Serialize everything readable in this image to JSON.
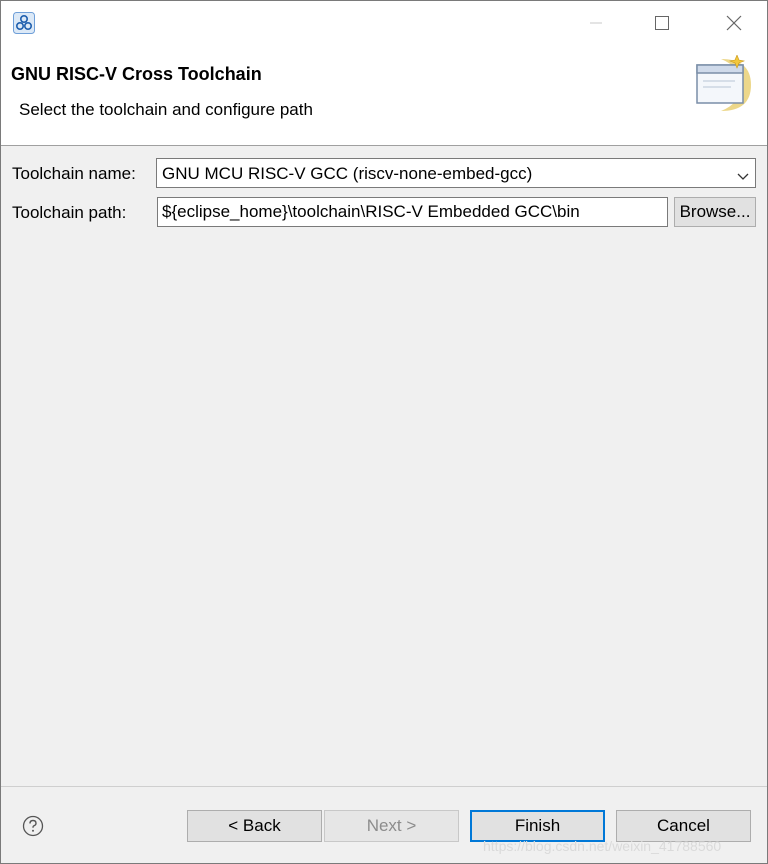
{
  "window": {
    "app_icon": "eclipse-app-icon",
    "controls": [
      "minimize-icon",
      "maximize-icon",
      "close-icon"
    ]
  },
  "header": {
    "title": "GNU RISC-V Cross Toolchain",
    "description": "Select the toolchain and configure path",
    "wizard_icon": "wizard-banner-icon"
  },
  "form": {
    "toolchain_name_label": "Toolchain name:",
    "toolchain_name_value": "GNU MCU RISC-V GCC (riscv-none-embed-gcc)",
    "toolchain_path_label": "Toolchain path:",
    "toolchain_path_value": "${eclipse_home}\\toolchain\\RISC-V Embedded GCC\\bin",
    "browse_label": "Browse..."
  },
  "footer": {
    "help_icon": "help-icon",
    "back_label": "< Back",
    "next_label": "Next >",
    "finish_label": "Finish",
    "cancel_label": "Cancel",
    "watermark": "https://blog.csdn.net/weixin_41788560"
  },
  "colors": {
    "focus_border": "#0078d7",
    "dialog_bg": "#f0f0f0",
    "header_bg": "#ffffff"
  }
}
